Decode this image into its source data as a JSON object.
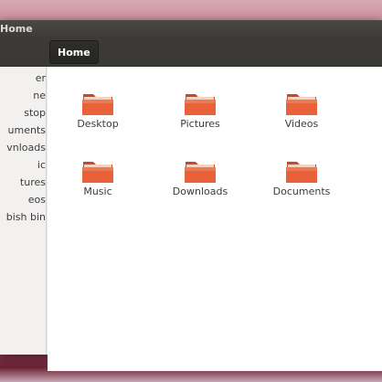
{
  "window": {
    "title": "Home"
  },
  "toolbar": {
    "path_button": "Home"
  },
  "sidebar": {
    "items": [
      {
        "label": "er"
      },
      {
        "label": "ne"
      },
      {
        "label": "stop"
      },
      {
        "label": "uments"
      },
      {
        "label": "vnloads"
      },
      {
        "label": "ic"
      },
      {
        "label": "tures"
      },
      {
        "label": "eos"
      },
      {
        "label": "bish bin"
      }
    ]
  },
  "folders": [
    {
      "label": "Desktop",
      "icon": "folder-icon"
    },
    {
      "label": "Pictures",
      "icon": "folder-icon"
    },
    {
      "label": "Videos",
      "icon": "folder-icon"
    },
    {
      "label": "Music",
      "icon": "folder-icon"
    },
    {
      "label": "Downloads",
      "icon": "folder-icon"
    },
    {
      "label": "Documents",
      "icon": "folder-icon"
    }
  ],
  "colors": {
    "folder_orange": "#e8613a",
    "folder_light": "#f0b9a3",
    "titlebar": "#3c3b37",
    "sidebar_bg": "#f2f1f0"
  }
}
